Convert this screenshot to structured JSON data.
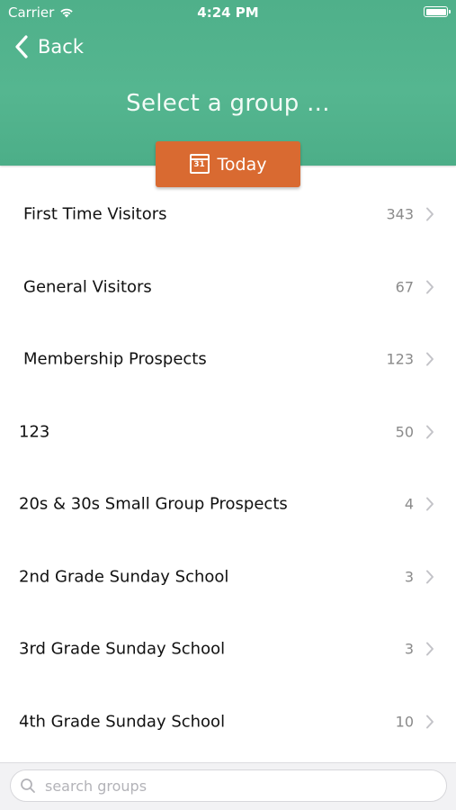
{
  "status_bar": {
    "carrier": "Carrier",
    "time": "4:24 PM"
  },
  "nav": {
    "back_label": "Back",
    "title": "Select a group ..."
  },
  "today_button": {
    "calendar_day": "31",
    "label": "Today"
  },
  "groups": [
    {
      "name": "First Time Visitors",
      "count": "343"
    },
    {
      "name": "General Visitors",
      "count": "67"
    },
    {
      "name": "Membership Prospects",
      "count": "123"
    },
    {
      "name": "123",
      "count": "50"
    },
    {
      "name": "20s & 30s Small Group Prospects",
      "count": "4"
    },
    {
      "name": "2nd Grade Sunday School",
      "count": "3"
    },
    {
      "name": "3rd Grade Sunday School",
      "count": "3"
    },
    {
      "name": "4th Grade Sunday School",
      "count": "10"
    }
  ],
  "search": {
    "placeholder": "search groups"
  },
  "colors": {
    "header_green": "#52b38d",
    "today_orange": "#d96a31"
  }
}
